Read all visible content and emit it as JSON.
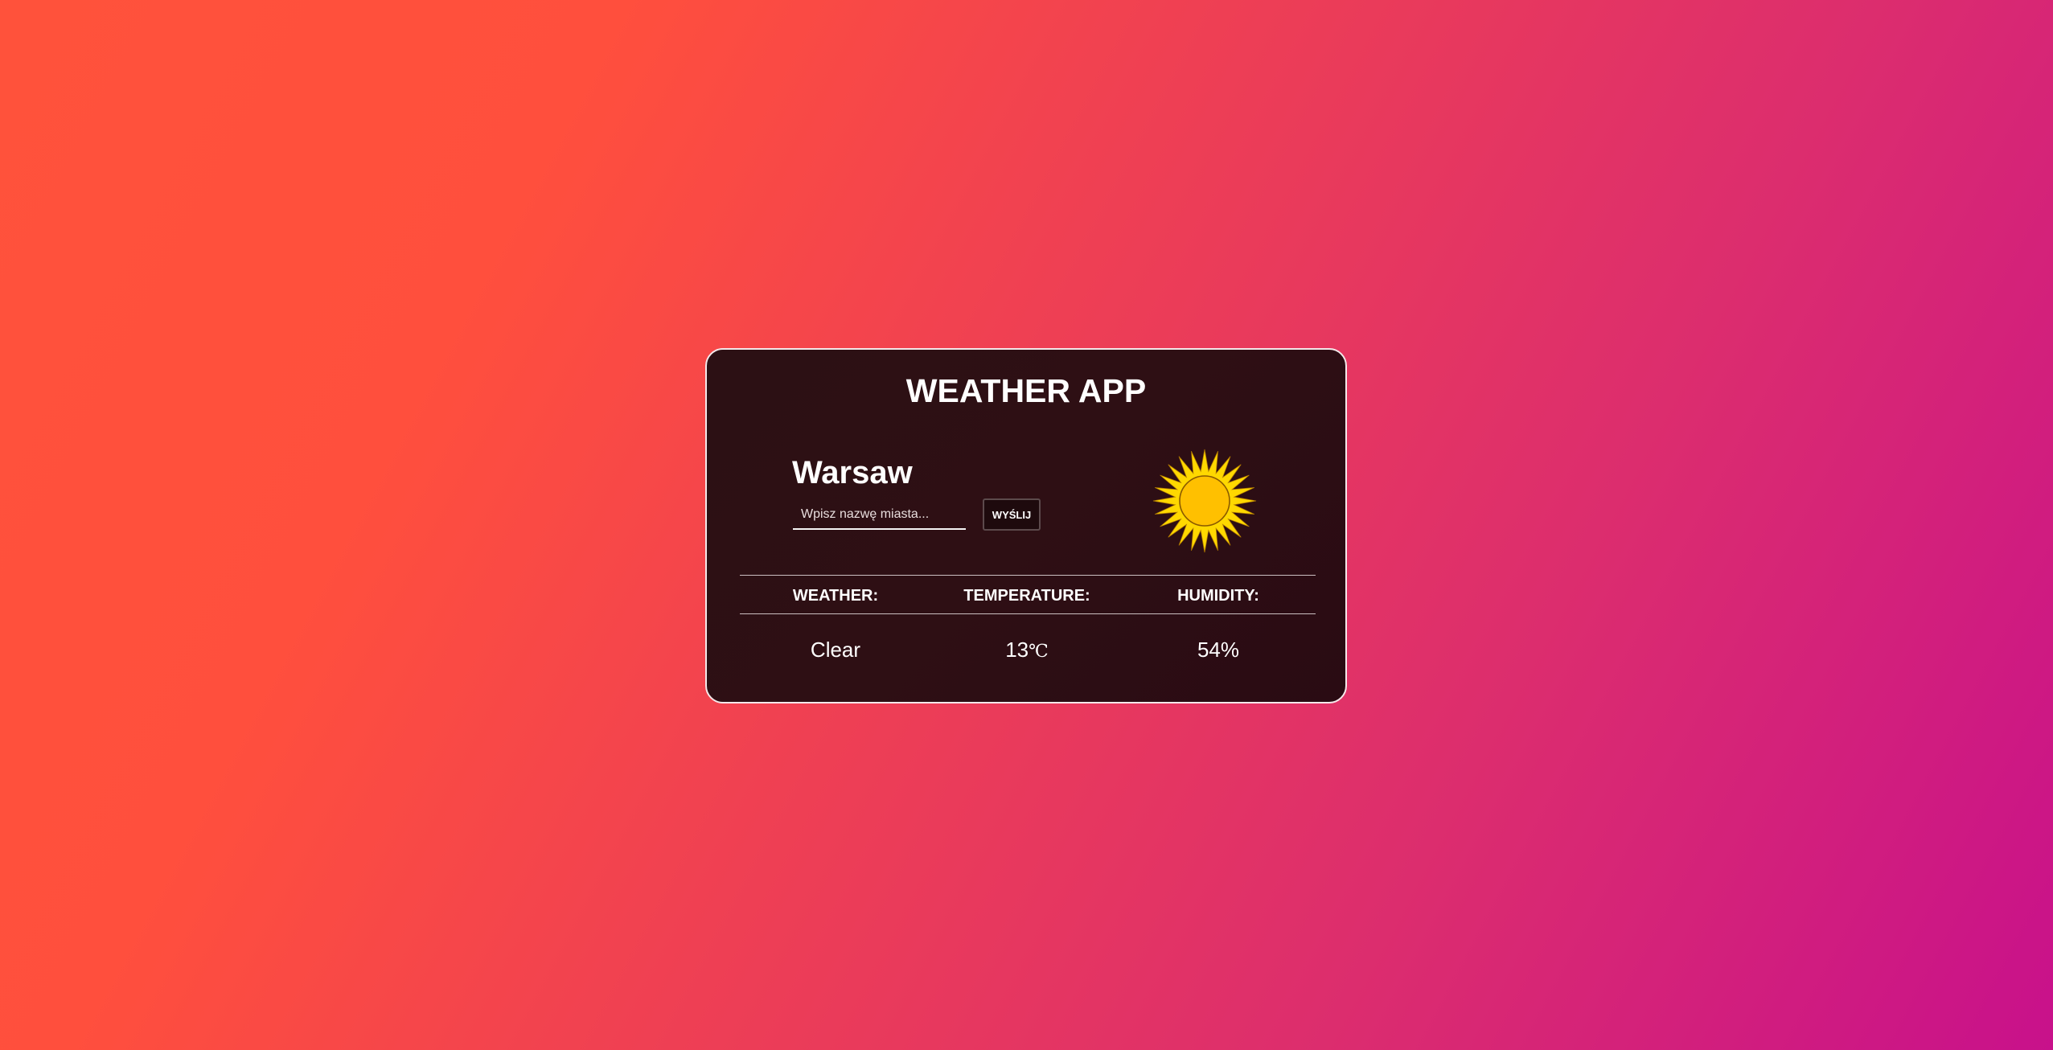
{
  "app": {
    "title": "WEATHER APP"
  },
  "location": {
    "city": "Warsaw"
  },
  "search": {
    "placeholder": "Wpisz nazwę miasta...",
    "value": "",
    "button_label": "WYŚLIJ"
  },
  "weather_icon": {
    "name": "sun-icon",
    "colors": {
      "rays": "#ffd800",
      "disc": "#ffc000",
      "outline": "#8a5a00"
    }
  },
  "table": {
    "headers": [
      "WEATHER:",
      "TEMPERATURE:",
      "HUMIDITY:"
    ],
    "values": {
      "weather": "Clear",
      "temperature": "13",
      "temperature_unit": "℃",
      "humidity": "54%"
    }
  },
  "colors": {
    "background_start": "#ff523b",
    "background_end": "#c8118b",
    "card_background": "#2c1014",
    "card_border": "#f4e8ea",
    "text": "#ffffff"
  }
}
